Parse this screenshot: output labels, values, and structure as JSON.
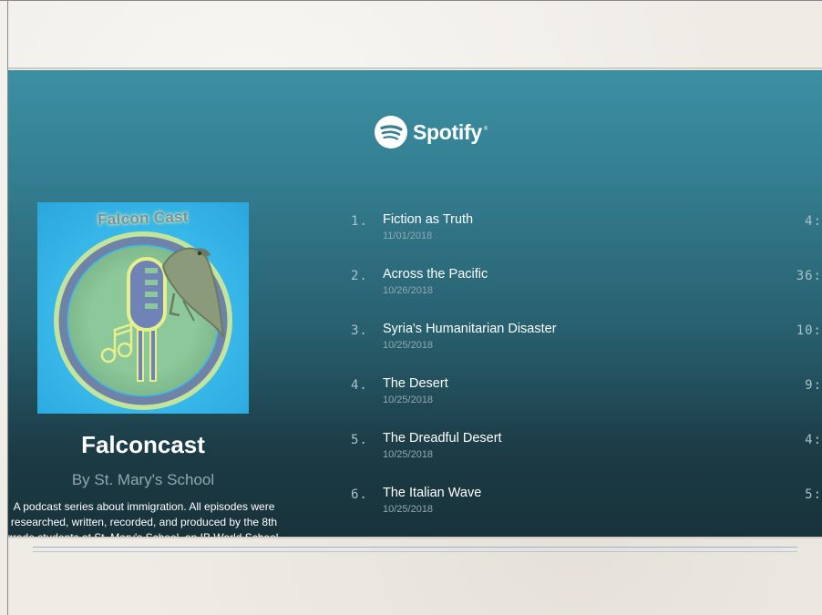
{
  "player": {
    "brand": "Spotify",
    "brand_mark": "®",
    "cover_title": "Falcon Cast",
    "show_title": "Falconcast",
    "author": "By St. Mary's School",
    "description": "A podcast series about immigration. All episodes were researched, written, recorded, and produced by the 8th grade students at St. Mary's School, an IB World School."
  },
  "episodes": [
    {
      "num": "1.",
      "title": "Fiction as Truth",
      "date": "11/01/2018",
      "duration": "4:"
    },
    {
      "num": "2.",
      "title": "Across the Pacific",
      "date": "10/26/2018",
      "duration": "36:"
    },
    {
      "num": "3.",
      "title": "Syria's Humanitarian Disaster",
      "date": "10/25/2018",
      "duration": "10:"
    },
    {
      "num": "4.",
      "title": "The Desert",
      "date": "10/25/2018",
      "duration": "9:"
    },
    {
      "num": "5.",
      "title": "The Dreadful Desert",
      "date": "10/25/2018",
      "duration": "4:"
    },
    {
      "num": "6.",
      "title": "The Italian Wave",
      "date": "10/25/2018",
      "duration": "5:"
    }
  ],
  "colors": {
    "embed_top": "#3c8fa3",
    "embed_bottom": "#18323a",
    "cover_bg": "#37b6e9"
  },
  "icons": [
    "spotify-icon",
    "microphone-icon",
    "falcon-icon",
    "music-note-icon"
  ]
}
